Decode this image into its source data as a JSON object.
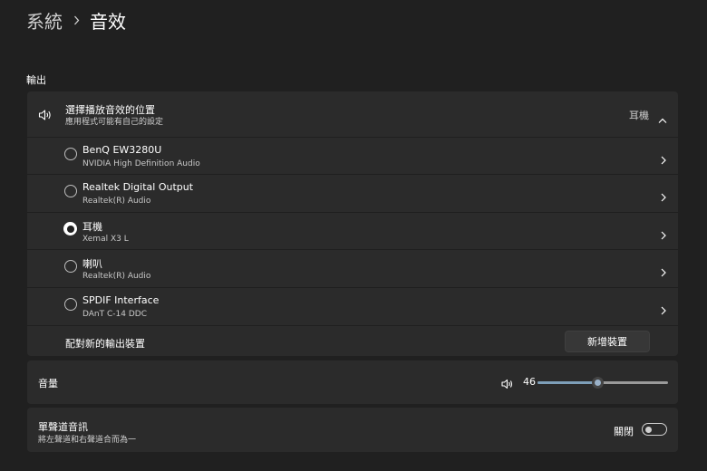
{
  "breadcrumb": {
    "parent": "系統",
    "current": "音效"
  },
  "output_section": {
    "label": "輸出"
  },
  "output_card": {
    "title": "選擇播放音效的位置",
    "subtitle": "應用程式可能有自己的設定",
    "selected": "耳機",
    "devices": [
      {
        "name": "BenQ EW3280U",
        "desc": "NVIDIA High Definition Audio",
        "selected": false
      },
      {
        "name": "Realtek Digital Output",
        "desc": "Realtek(R) Audio",
        "selected": false
      },
      {
        "name": "耳機",
        "desc": "Xemal X3 L",
        "selected": true
      },
      {
        "name": "喇叭",
        "desc": "Realtek(R) Audio",
        "selected": false
      },
      {
        "name": "SPDIF Interface",
        "desc": "DAnT C-14 DDC",
        "selected": false
      }
    ],
    "pair_label": "配對新的輸出裝置",
    "add_button": "新增裝置"
  },
  "volume": {
    "label": "音量",
    "value": 46
  },
  "mono": {
    "title": "單聲道音訊",
    "subtitle": "將左聲道和右聲道合而為一",
    "state": "關閉"
  },
  "colors": {
    "background": "#202020",
    "card": "#2b2b2b",
    "accent": "#7e9fb9",
    "text_secondary": "#cfcfcf"
  },
  "icons": {
    "speaker": "speaker-icon",
    "volume": "volume-icon",
    "chevron_up": "chevron-up-icon",
    "chevron_right": "chevron-right-icon",
    "breadcrumb_separator": "chevron-right-icon"
  }
}
